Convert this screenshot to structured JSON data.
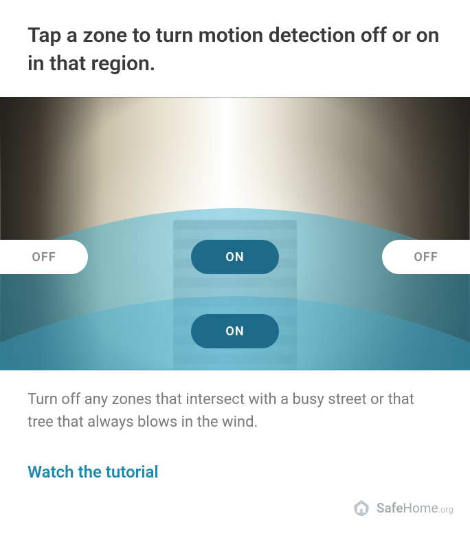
{
  "header": {
    "title": "Tap a zone to turn motion detection off or on in that region."
  },
  "zones": {
    "top_left": {
      "label": "OFF",
      "state": "off"
    },
    "top_center": {
      "label": "ON",
      "state": "on"
    },
    "top_right": {
      "label": "OFF",
      "state": "off"
    },
    "bottom_center": {
      "label": "ON",
      "state": "on"
    }
  },
  "description": {
    "text": "Turn off any zones that intersect with a busy street or that tree that always blows in the wind."
  },
  "tutorial": {
    "label": "Watch the tutorial"
  },
  "watermark": {
    "brand_safe": "Safe",
    "brand_home": "Home",
    "tld": ".org"
  },
  "colors": {
    "accent": "#1a8ab0",
    "pill_on_bg": "#1d6a8a",
    "overlay": "rgba(60,175,210,0.48)"
  }
}
